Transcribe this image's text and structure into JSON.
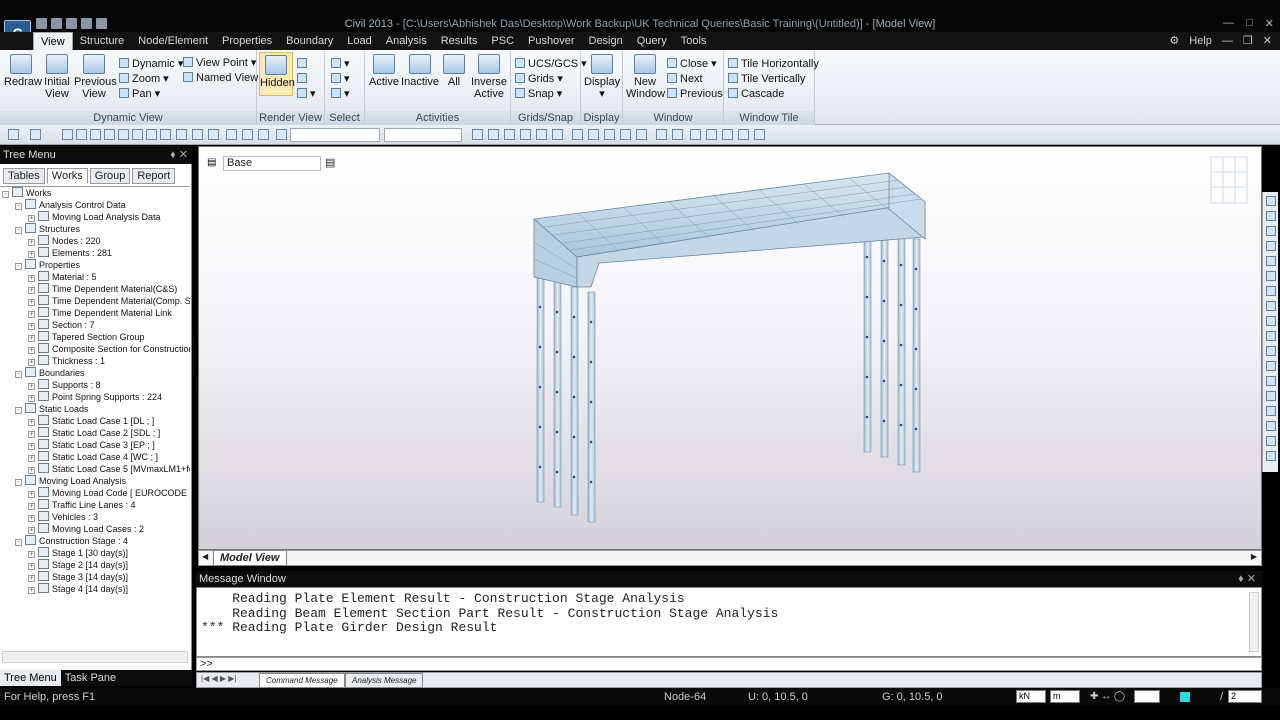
{
  "window": {
    "title_app": "Civil 2013 - ",
    "title_path": "[C:\\Users\\Abhishek Das\\Desktop\\Work Backup\\UK Technical Queries\\Basic Training\\(Untitled)]",
    "title_view": " - [Model View]"
  },
  "menu": {
    "items": [
      "View",
      "Structure",
      "Node/Element",
      "Properties",
      "Boundary",
      "Load",
      "Analysis",
      "Results",
      "PSC",
      "Pushover",
      "Design",
      "Query",
      "Tools"
    ],
    "help": "Help"
  },
  "ribbon": {
    "dynamic_view": {
      "label": "Dynamic View",
      "redraw": "Redraw",
      "initial": "Initial\nView",
      "previous": "Previous\nView",
      "dynamic": "Dynamic",
      "zoom": "Zoom",
      "pan": "Pan",
      "view_point": "View Point",
      "named_view": "Named View"
    },
    "render_view": {
      "label": "Render View",
      "hidden": "Hidden"
    },
    "select": {
      "label": "Select"
    },
    "activities": {
      "label": "Activities",
      "active": "Active",
      "inactive": "Inactive",
      "all": "All",
      "inverse": "Inverse\nActive"
    },
    "grids_snap": {
      "label": "Grids/Snap",
      "ucs": "UCS/GCS",
      "grids": "Grids",
      "snap": "Snap"
    },
    "display": {
      "label": "Display",
      "display": "Display"
    },
    "window": {
      "label": "Window",
      "new": "New\nWindow",
      "close": "Close",
      "next": "Next",
      "previous": "Previous"
    },
    "window_tile": {
      "label": "Window Tile",
      "horiz": "Tile Horizontally",
      "vert": "Tile Vertically",
      "cascade": "Cascade"
    }
  },
  "tree": {
    "header": "Tree Menu",
    "tabs": [
      "Tables",
      "Works",
      "Group",
      "Report"
    ],
    "nodes": [
      {
        "level": 0,
        "label": "Works"
      },
      {
        "level": 1,
        "label": "Analysis Control Data"
      },
      {
        "level": 2,
        "label": "Moving Load Analysis Data"
      },
      {
        "level": 1,
        "label": "Structures"
      },
      {
        "level": 2,
        "label": "Nodes : 220"
      },
      {
        "level": 2,
        "label": "Elements : 281"
      },
      {
        "level": 1,
        "label": "Properties"
      },
      {
        "level": 2,
        "label": "Material : 5"
      },
      {
        "level": 2,
        "label": "Time Dependent Material(C&S)"
      },
      {
        "level": 2,
        "label": "Time Dependent Material(Comp. Stre"
      },
      {
        "level": 2,
        "label": "Time Dependent Material Link"
      },
      {
        "level": 2,
        "label": "Section : 7"
      },
      {
        "level": 2,
        "label": "Tapered Section Group"
      },
      {
        "level": 2,
        "label": "Composite Section for Construction S"
      },
      {
        "level": 2,
        "label": "Thickness : 1"
      },
      {
        "level": 1,
        "label": "Boundaries"
      },
      {
        "level": 2,
        "label": "Supports : 8"
      },
      {
        "level": 2,
        "label": "Point Spring Supports : 224"
      },
      {
        "level": 1,
        "label": "Static Loads"
      },
      {
        "level": 2,
        "label": "Static Load Case 1 [DL ; ]"
      },
      {
        "level": 2,
        "label": "Static Load Case 2 [SDL ; ]"
      },
      {
        "level": 2,
        "label": "Static Load Case 3 [EP ; ]"
      },
      {
        "level": 2,
        "label": "Static Load Case 4 [WC ; ]"
      },
      {
        "level": 2,
        "label": "Static Load Case 5 [MVmaxLM1+foot"
      },
      {
        "level": 1,
        "label": "Moving Load Analysis"
      },
      {
        "level": 2,
        "label": "Moving Load Code [ EUROCODE ]"
      },
      {
        "level": 2,
        "label": "Traffic Line Lanes : 4"
      },
      {
        "level": 2,
        "label": "Vehicles : 3"
      },
      {
        "level": 2,
        "label": "Moving Load Cases : 2"
      },
      {
        "level": 1,
        "label": "Construction Stage : 4"
      },
      {
        "level": 2,
        "label": "Stage 1 [30 day(s)]"
      },
      {
        "level": 2,
        "label": "Stage 2 [14 day(s)]"
      },
      {
        "level": 2,
        "label": "Stage 3 [14 day(s)]"
      },
      {
        "level": 2,
        "label": "Stage 4 [14 day(s)]"
      }
    ],
    "footer_tabs": [
      "Tree Menu",
      "Task Pane"
    ]
  },
  "view": {
    "base_label": "Base",
    "tab": "Model View"
  },
  "messages": {
    "header": "Message Window",
    "lines": [
      "    Reading Plate Element Result - Construction Stage Analysis",
      "    Reading Beam Element Section Part Result - Construction Stage Analysis",
      "*** Reading Plate Girder Design Result"
    ],
    "prompt": ">>",
    "tabs": [
      "Command Message",
      "Analysis Message"
    ]
  },
  "status": {
    "help": "For Help, press F1",
    "node": "Node-64",
    "ucs": "U: 0, 10.5, 0",
    "gcs": "G: 0, 10.5, 0",
    "force_unit": "kN",
    "length_unit": "m",
    "page": "2",
    "page_sep": "/"
  }
}
